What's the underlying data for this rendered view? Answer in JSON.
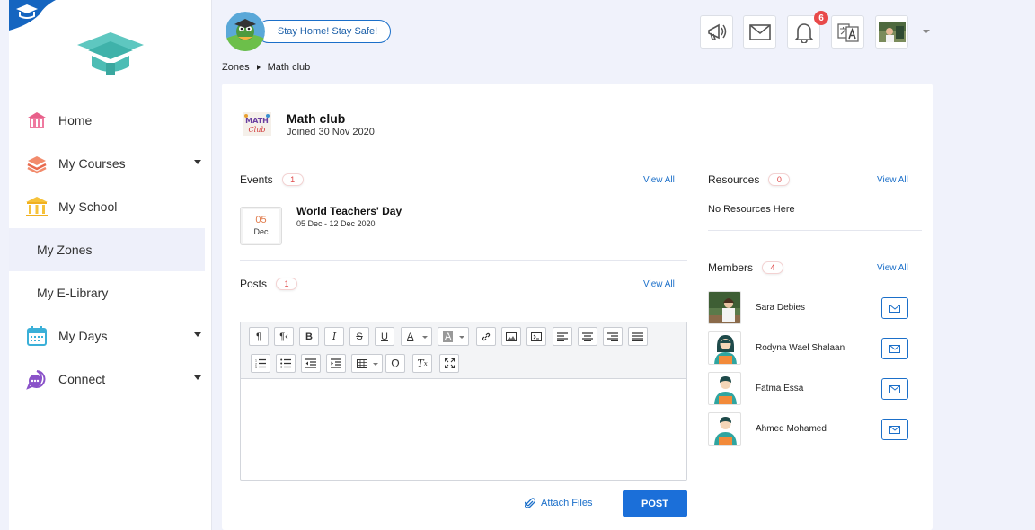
{
  "sidebar": {
    "items": [
      {
        "label": "Home"
      },
      {
        "label": "My Courses"
      },
      {
        "label": "My School"
      },
      {
        "label": "My Zones"
      },
      {
        "label": "My E-Library"
      },
      {
        "label": "My Days"
      },
      {
        "label": "Connect"
      }
    ]
  },
  "topbar": {
    "stay_label": "Stay Home! Stay Safe!",
    "notification_count": "6"
  },
  "breadcrumb": {
    "root": "Zones",
    "current": "Math club"
  },
  "club": {
    "name": "Math club",
    "joined": "Joined 30 Nov 2020"
  },
  "events": {
    "title": "Events",
    "count": "1",
    "view_all": "View All",
    "items": [
      {
        "day": "05",
        "month": "Dec",
        "title": "World Teachers' Day",
        "range": "05 Dec - 12 Dec 2020"
      }
    ]
  },
  "posts": {
    "title": "Posts",
    "count": "1",
    "view_all": "View All",
    "attach_label": "Attach Files",
    "post_label": "POST"
  },
  "resources": {
    "title": "Resources",
    "count": "0",
    "view_all": "View All",
    "empty": "No Resources Here"
  },
  "members": {
    "title": "Members",
    "count": "4",
    "view_all": "View All",
    "items": [
      {
        "name": "Sara Debies",
        "avatar": "photo"
      },
      {
        "name": "Rodyna Wael Shalaan",
        "avatar": "female-student"
      },
      {
        "name": "Fatma Essa",
        "avatar": "male-student"
      },
      {
        "name": "Ahmed Mohamed",
        "avatar": "male-student"
      }
    ]
  },
  "colors": {
    "accent": "#1b6fd9",
    "badge": "#e84a4a",
    "active_nav": "#eef0fa"
  }
}
